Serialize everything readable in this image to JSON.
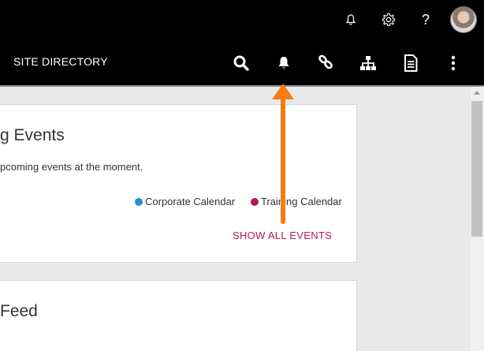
{
  "top_bar": {
    "icons": [
      "bell-outline-icon",
      "gear-icon",
      "help-icon"
    ],
    "help_glyph": "?"
  },
  "nav": {
    "site_directory_label": "SITE DIRECTORY",
    "icons": [
      "search-icon",
      "bell-icon",
      "link-icon",
      "sitemap-icon",
      "document-icon",
      "more-vertical-icon"
    ]
  },
  "events_card": {
    "title": "g Events",
    "empty_message": "pcoming events at the moment.",
    "legend": [
      {
        "label": "Corporate Calendar",
        "color": "#2a8fd0"
      },
      {
        "label": "Training Calendar",
        "color": "#b3195a"
      }
    ],
    "show_all_label": "SHOW ALL EVENTS"
  },
  "feed_card": {
    "title": "Feed"
  },
  "colors": {
    "accent_link": "#b3195a",
    "annotation_arrow": "#f57c12",
    "bar_bg": "#000000"
  }
}
